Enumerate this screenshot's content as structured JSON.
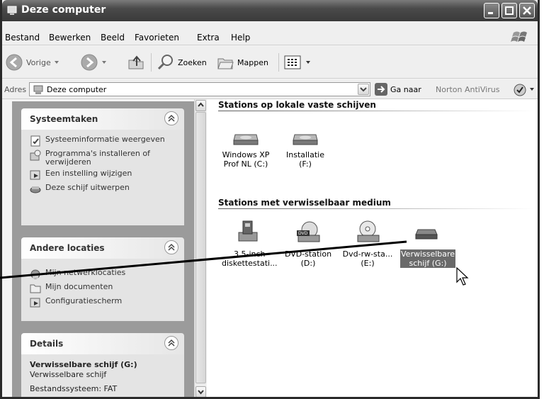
{
  "window": {
    "title": "Deze computer"
  },
  "menu": [
    "Bestand",
    "Bewerken",
    "Beeld",
    "Favorieten",
    "Extra",
    "Help"
  ],
  "toolbar": {
    "back": "Vorige",
    "search": "Zoeken",
    "folders": "Mappen"
  },
  "address": {
    "label": "Adres",
    "value": "Deze computer",
    "go": "Ga naar",
    "norton": "Norton AntiVirus"
  },
  "sidebar": {
    "system_tasks": {
      "title": "Systeemtaken",
      "items": [
        {
          "label": "Systeeminformatie weergeven",
          "icon": "system-info-icon"
        },
        {
          "label": "Programma's installeren of verwijderen",
          "icon": "add-remove-programs-icon"
        },
        {
          "label": "Een instelling wijzigen",
          "icon": "control-panel-icon"
        },
        {
          "label": "Deze schijf uitwerpen",
          "icon": "eject-icon"
        }
      ]
    },
    "other_places": {
      "title": "Andere locaties",
      "items": [
        {
          "label": "Mijn netwerklocaties",
          "icon": "network-places-icon"
        },
        {
          "label": "Mijn documenten",
          "icon": "documents-icon"
        },
        {
          "label": "Configuratiescherm",
          "icon": "control-panel-icon"
        }
      ]
    },
    "details": {
      "title": "Details",
      "name": "Verwisselbare schijf (G:)",
      "type": "Verwisselbare schijf",
      "filesystem": "Bestandssysteem: FAT"
    }
  },
  "content": {
    "fixed_title": "Stations op lokale vaste schijven",
    "fixed_drives": [
      {
        "label": "Windows XP Prof NL (C:)",
        "icon": "hard-disk-icon"
      },
      {
        "label": "Installatie (F:)",
        "icon": "hard-disk-icon"
      }
    ],
    "removable_title": "Stations met verwisselbaar medium",
    "removable_drives": [
      {
        "label": "3,5-inch diskettestati...",
        "icon": "floppy-drive-icon"
      },
      {
        "label": "DVD-station (D:)",
        "icon": "dvd-drive-icon"
      },
      {
        "label": "Dvd-rw-sta... (E:)",
        "icon": "cd-drive-icon"
      },
      {
        "label": "Verwisselbare schijf (G:)",
        "icon": "removable-disk-icon",
        "selected": true
      }
    ]
  }
}
